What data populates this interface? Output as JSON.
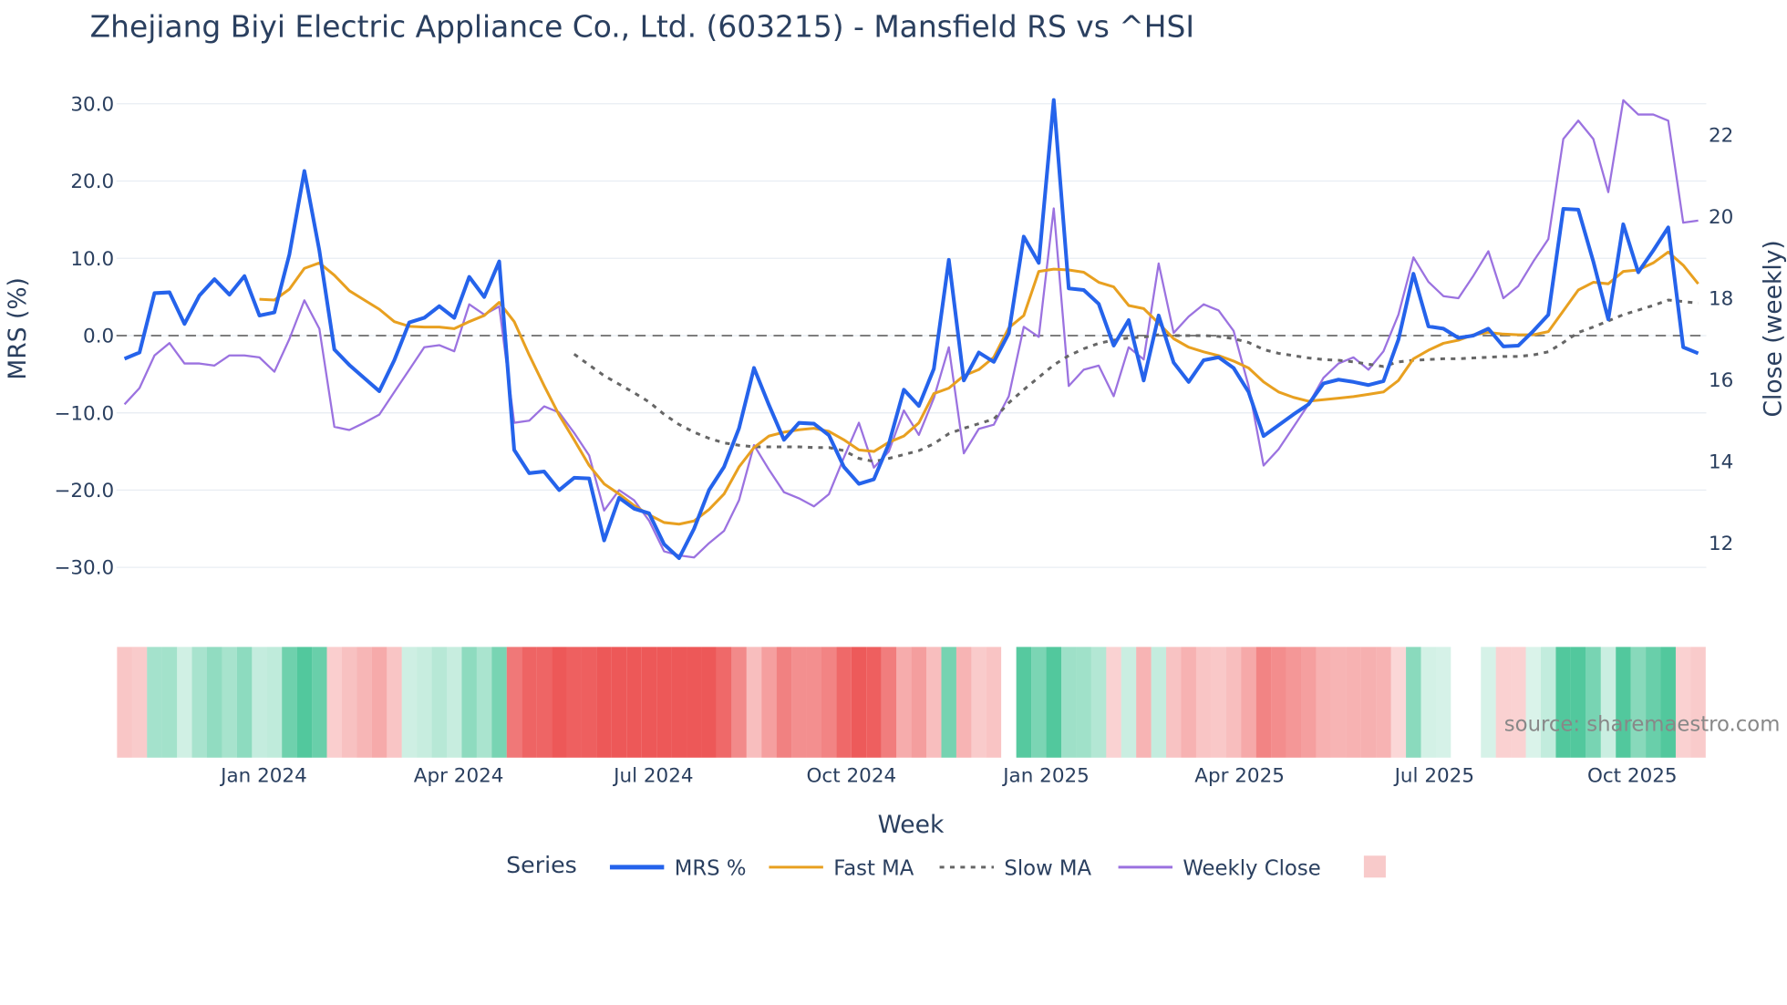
{
  "chart_data": {
    "type": "line",
    "title": "Zhejiang Biyi Electric Appliance Co., Ltd. (603215) - Mansfield RS vs ^HSI",
    "xlabel": "Week",
    "ylabel": "MRS (%)",
    "y2label": "Close (weekly)",
    "ylim": [
      -33,
      31
    ],
    "y2lim": [
      11.3,
      23.4
    ],
    "yticks": [
      "30.0",
      "20.0",
      "10.0",
      "0.0",
      "−10.0",
      "−20.0",
      "−30.0"
    ],
    "ytick_values": [
      30,
      20,
      10,
      0,
      -10,
      -20,
      -30
    ],
    "y2ticks": [
      "22",
      "20",
      "18",
      "16",
      "14",
      "12"
    ],
    "y2tick_values": [
      22,
      20,
      18,
      16,
      14,
      12
    ],
    "xticks": [
      "Jan 2024",
      "Apr 2024",
      "Jul 2024",
      "Oct 2024",
      "Jan 2025",
      "Apr 2025",
      "Jul 2025",
      "Oct 2025"
    ],
    "xtick_week_index": [
      9.3,
      22.3,
      35.3,
      48.5,
      61.5,
      74.4,
      87.4,
      100.6
    ],
    "source": "source: sharemaestro.com",
    "legend_title": "Series",
    "legend_position": "bottom",
    "series": [
      {
        "name": "MRS %",
        "color": "#2563eb",
        "axis": "left",
        "values": [
          -3,
          -2.2,
          5.5,
          5.6,
          1.5,
          5.2,
          7.3,
          5.3,
          7.7,
          2.6,
          3,
          10.5,
          21.3,
          11,
          -1.8,
          -3.8,
          -5.5,
          -7.2,
          -3.2,
          1.7,
          2.3,
          3.8,
          2.3,
          7.6,
          5,
          9.6,
          -14.8,
          -17.8,
          -17.6,
          -20,
          -18.4,
          -18.5,
          -26.5,
          -21,
          -22.4,
          -23,
          -27,
          -28.8,
          -25,
          -20,
          -17,
          -12,
          -4.2,
          -9,
          -13.5,
          -11.3,
          -11.4,
          -12.9,
          -17,
          -19.2,
          -18.6,
          -14,
          -7,
          -9.1,
          -4.3,
          9.8,
          -5.8,
          -2.2,
          -3.4,
          0.3,
          12.8,
          9.4,
          30.5,
          6.1,
          5.9,
          4.1,
          -1.3,
          2,
          -5.8,
          2.6,
          -3.5,
          -6,
          -3.2,
          -2.8,
          -4.2,
          -7.3,
          -13,
          -11.6,
          -10.2,
          -8.9,
          -6.2,
          -5.7,
          -6,
          -6.4,
          -5.9,
          -0.5,
          8,
          1.2,
          0.9,
          -0.3,
          0,
          0.9,
          -1.4,
          -1.3,
          0.6,
          2.7,
          16.4,
          16.3,
          9.6,
          2.1,
          14.4,
          8.2,
          11,
          14,
          -1.5,
          -2.3
        ]
      },
      {
        "name": "Fast MA",
        "color": "#e8a020",
        "axis": "left",
        "values": [
          null,
          null,
          null,
          null,
          null,
          null,
          null,
          null,
          null,
          4.7,
          4.6,
          6,
          8.7,
          9.4,
          7.8,
          5.8,
          4.6,
          3.4,
          1.8,
          1.2,
          1.1,
          1.1,
          0.9,
          1.8,
          2.6,
          4.3,
          1.8,
          -2.5,
          -6.5,
          -10.3,
          -13.5,
          -16.8,
          -19.2,
          -20.5,
          -22,
          -23.2,
          -24.2,
          -24.4,
          -24,
          -22.5,
          -20.5,
          -17,
          -14.5,
          -13,
          -12.5,
          -12.2,
          -12,
          -12.4,
          -13.5,
          -14.8,
          -15,
          -13.8,
          -13,
          -11.3,
          -7.5,
          -6.8,
          -5.2,
          -4.4,
          -2.8,
          1,
          2.6,
          8.3,
          8.6,
          8.5,
          8.2,
          6.9,
          6.3,
          3.9,
          3.5,
          1.6,
          -0.4,
          -1.5,
          -2.1,
          -2.6,
          -3.3,
          -4.2,
          -6,
          -7.3,
          -8,
          -8.5,
          -8.3,
          -8.1,
          -7.9,
          -7.6,
          -7.3,
          -5.8,
          -3,
          -1.9,
          -1,
          -0.6,
          0.1,
          0.4,
          0.2,
          0.1,
          0.1,
          0.5,
          3.2,
          5.9,
          6.9,
          6.7,
          8.3,
          8.5,
          9.4,
          10.8,
          9.1,
          6.7
        ]
      },
      {
        "name": "Slow MA",
        "color": "#666666",
        "axis": "left",
        "dash": true,
        "values": [
          null,
          null,
          null,
          null,
          null,
          null,
          null,
          null,
          null,
          null,
          null,
          null,
          null,
          null,
          null,
          null,
          null,
          null,
          null,
          null,
          null,
          null,
          null,
          null,
          null,
          null,
          null,
          null,
          null,
          null,
          -2.4,
          -3.8,
          -5.2,
          -6.3,
          -7.4,
          -8.6,
          -10.2,
          -11.5,
          -12.5,
          -13.3,
          -13.9,
          -14.2,
          -14.4,
          -14.4,
          -14.4,
          -14.4,
          -14.5,
          -14.5,
          -14.9,
          -15.9,
          -16.3,
          -15.9,
          -15.4,
          -14.9,
          -14,
          -12.7,
          -12,
          -11.4,
          -10.8,
          -8.7,
          -7,
          -5.4,
          -3.8,
          -2.6,
          -1.7,
          -1,
          -0.6,
          -0.3,
          -0.2,
          0.1,
          0,
          0,
          0,
          -0.1,
          -0.4,
          -0.9,
          -1.8,
          -2.3,
          -2.6,
          -2.9,
          -3.1,
          -3.2,
          -3.4,
          -3.7,
          -4,
          -3.4,
          -3.2,
          -3.1,
          -3,
          -3,
          -2.9,
          -2.8,
          -2.7,
          -2.7,
          -2.5,
          -2.1,
          -0.9,
          0.4,
          1.1,
          1.9,
          2.7,
          3.3,
          3.9,
          4.6,
          4.4,
          4.2
        ]
      },
      {
        "name": "Weekly Close",
        "color": "#9b72e0",
        "axis": "right",
        "values": [
          15.4,
          15.8,
          16.6,
          16.9,
          16.4,
          16.4,
          16.35,
          16.6,
          16.6,
          16.55,
          16.2,
          17,
          17.95,
          17.25,
          14.85,
          14.77,
          14.95,
          15.15,
          15.7,
          16.25,
          16.8,
          16.85,
          16.7,
          17.85,
          17.6,
          17.8,
          14.95,
          15,
          15.35,
          15.2,
          14.7,
          14.15,
          12.8,
          13.3,
          13.05,
          12.55,
          11.8,
          11.7,
          11.65,
          12,
          12.3,
          13.05,
          14.4,
          13.8,
          13.25,
          13.1,
          12.9,
          13.2,
          14.1,
          14.95,
          13.85,
          14.25,
          15.25,
          14.65,
          15.55,
          16.8,
          14.2,
          14.8,
          14.9,
          15.6,
          17.3,
          17.05,
          20.2,
          15.85,
          16.25,
          16.35,
          15.6,
          16.8,
          16.5,
          18.85,
          17.15,
          17.55,
          17.85,
          17.7,
          17.2,
          15.85,
          13.9,
          14.3,
          14.85,
          15.4,
          16.05,
          16.4,
          16.55,
          16.25,
          16.7,
          17.6,
          19,
          18.4,
          18.05,
          18,
          18.55,
          19.15,
          18,
          18.3,
          18.9,
          19.45,
          21.9,
          22.35,
          21.9,
          20.6,
          22.85,
          22.5,
          22.5,
          22.35,
          19.85,
          19.9
        ]
      }
    ]
  }
}
